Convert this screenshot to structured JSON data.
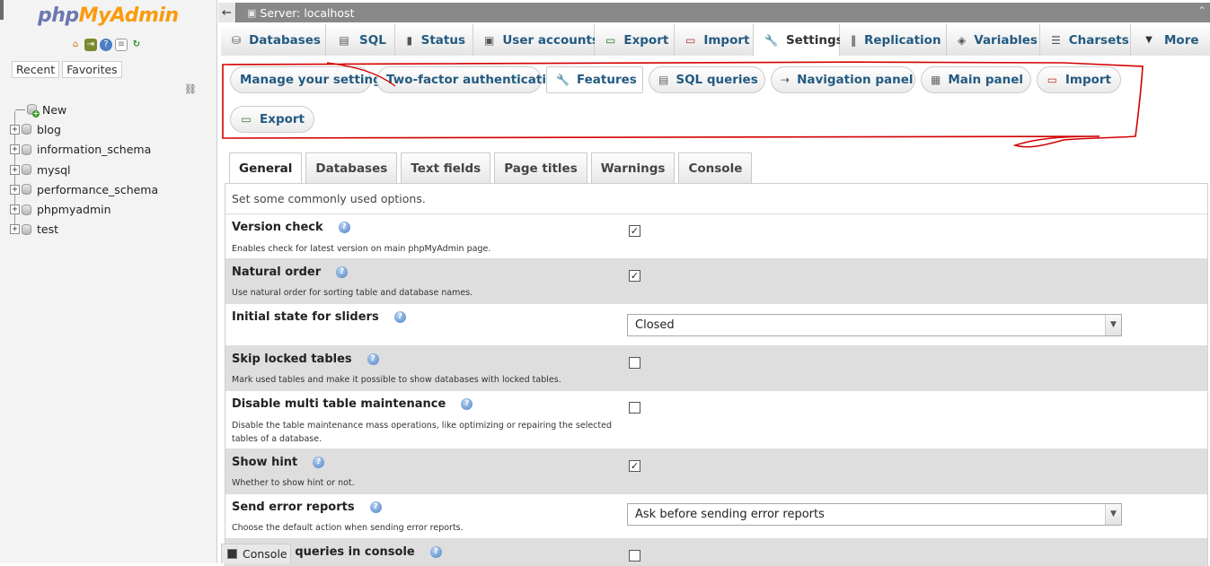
{
  "logo": {
    "part1": "php",
    "part2": "MyAdmin"
  },
  "nav": {
    "logo_icons": [
      "home-icon",
      "exit-icon",
      "help-icon",
      "docs-icon",
      "reload-icon"
    ],
    "recent_label": "Recent",
    "favorites_label": "Favorites",
    "new_label": "New",
    "databases": [
      "blog",
      "information_schema",
      "mysql",
      "performance_schema",
      "phpmyadmin",
      "test"
    ]
  },
  "serverbar": {
    "label": "Server: localhost",
    "collapse": "←",
    "right_glyph": "⌃"
  },
  "tabs": [
    {
      "label": "Databases",
      "icon": "databases-icon",
      "glyph": "⛁"
    },
    {
      "label": "SQL",
      "icon": "sql-icon",
      "glyph": "▤"
    },
    {
      "label": "Status",
      "icon": "status-icon",
      "glyph": "▮"
    },
    {
      "label": "User accounts",
      "icon": "user-accounts-icon",
      "glyph": "▣"
    },
    {
      "label": "Export",
      "icon": "export-icon",
      "glyph": "▭"
    },
    {
      "label": "Import",
      "icon": "import-icon",
      "glyph": "▭"
    },
    {
      "label": "Settings",
      "icon": "settings-icon",
      "glyph": "🔧"
    },
    {
      "label": "Replication",
      "icon": "replication-icon",
      "glyph": "‖"
    },
    {
      "label": "Variables",
      "icon": "variables-icon",
      "glyph": "◈"
    },
    {
      "label": "Charsets",
      "icon": "charsets-icon",
      "glyph": "☰"
    },
    {
      "label": "More",
      "icon": "more-icon",
      "glyph": "▼"
    }
  ],
  "subtabs": [
    {
      "label": "Manage your settings"
    },
    {
      "label": "Two-factor authentication"
    },
    {
      "label": "Features",
      "icon": "wrench-icon",
      "glyph": "🔧"
    },
    {
      "label": "SQL queries",
      "icon": "sql-icon",
      "glyph": "▤"
    },
    {
      "label": "Navigation panel",
      "icon": "navigation-icon",
      "glyph": "⇢"
    },
    {
      "label": "Main panel",
      "icon": "main-panel-icon",
      "glyph": "▦"
    },
    {
      "label": "Import",
      "icon": "import-icon",
      "glyph": "▭"
    },
    {
      "label": "Export",
      "icon": "export-icon",
      "glyph": "▭"
    }
  ],
  "config_tabs": [
    "General",
    "Databases",
    "Text fields",
    "Page titles",
    "Warnings",
    "Console"
  ],
  "form": {
    "description": "Set some commonly used options.",
    "rows": [
      {
        "name": "Version check",
        "desc": "Enables check for latest version on main phpMyAdmin page.",
        "type": "checkbox",
        "checked": true
      },
      {
        "name": "Natural order",
        "desc": "Use natural order for sorting table and database names.",
        "type": "checkbox",
        "checked": true
      },
      {
        "name": "Initial state for sliders",
        "desc": "",
        "type": "select",
        "value": "Closed"
      },
      {
        "name": "Skip locked tables",
        "desc": "Mark used tables and make it possible to show databases with locked tables.",
        "type": "checkbox",
        "checked": false
      },
      {
        "name": "Disable multi table maintenance",
        "desc": "Disable the table maintenance mass operations, like optimizing or repairing the selected tables of a database.",
        "type": "checkbox",
        "checked": false
      },
      {
        "name": "Show hint",
        "desc": "Whether to show hint or not.",
        "type": "checkbox",
        "checked": true
      },
      {
        "name": "Send error reports",
        "desc": "Choose the default action when sending error reports.",
        "type": "select",
        "value": "Ask before sending error reports"
      },
      {
        "name": "Executes queries in console",
        "desc": "",
        "type": "checkbox",
        "checked": false
      }
    ]
  },
  "console": {
    "label": "Console"
  },
  "colors": {
    "link": "#235a81",
    "annotation": "#d40000",
    "brand_php": "#6c78af",
    "brand_admin": "#f89c0e"
  }
}
